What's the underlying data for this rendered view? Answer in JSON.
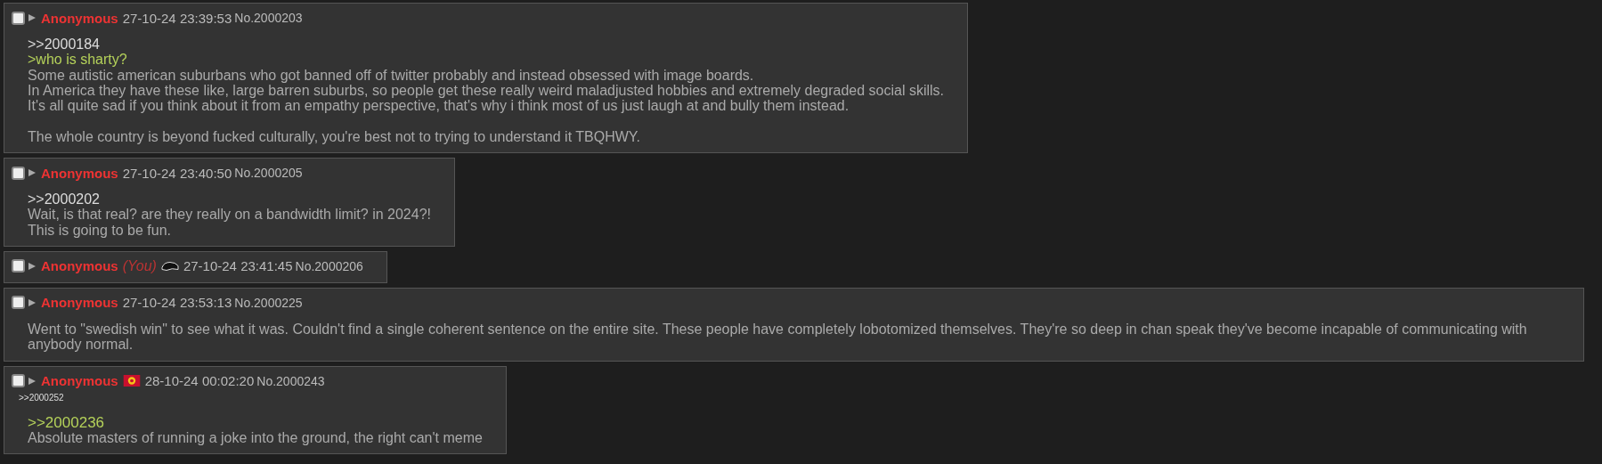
{
  "posts": [
    {
      "checked": false,
      "name": "Anonymous",
      "date": "27-10-24 23:39:53",
      "number": "No.2000203",
      "body": [
        {
          "kind": "quotelink",
          "text": ">>2000184"
        },
        {
          "kind": "greentext",
          "text": ">who is sharty?"
        },
        {
          "kind": "text",
          "text": "Some autistic american suburbans who got banned off of twitter probably and instead obsessed with image boards."
        },
        {
          "kind": "text",
          "text": "In America they have these like, large barren suburbs, so people get these really weird maladjusted hobbies and extremely degraded social skills."
        },
        {
          "kind": "text",
          "text": "It's all quite sad if you think about it from an empathy perspective, that's why i think most of us just laugh at and bully them instead."
        },
        {
          "kind": "gap"
        },
        {
          "kind": "text",
          "text": "The whole country is beyond fucked culturally, you're best not to trying to understand it TBQHWY."
        }
      ]
    },
    {
      "checked": false,
      "name": "Anonymous",
      "date": "27-10-24 23:40:50",
      "number": "No.2000205",
      "body": [
        {
          "kind": "quotelink",
          "text": ">>2000202"
        },
        {
          "kind": "text",
          "text": "Wait, is that real? are they really on a bandwidth limit? in 2024?!"
        },
        {
          "kind": "text",
          "text": "This is going to be fun."
        }
      ]
    },
    {
      "checked": false,
      "name": "Anonymous",
      "you": "(You)",
      "flag": {
        "kind": "cap"
      },
      "date": "27-10-24 23:41:45",
      "number": "No.2000206"
    },
    {
      "checked": false,
      "name": "Anonymous",
      "date": "27-10-24 23:53:13",
      "number": "No.2000225",
      "body": [
        {
          "kind": "text",
          "text": "Went to \"swedish win\" to see what it was. Couldn't find a single coherent sentence on the entire site. These people have completely lobotomized themselves. They're so deep in chan speak they've become incapable of communicating with anybody normal."
        }
      ]
    },
    {
      "checked": false,
      "name": "Anonymous",
      "flag": {
        "kind": "sun"
      },
      "date": "28-10-24 00:02:20",
      "number": "No.2000243",
      "backlinks": [
        ">>2000252"
      ],
      "body": [
        {
          "kind": "greenlink",
          "text": ">>2000236"
        },
        {
          "kind": "text",
          "text": "Absolute masters of running a joke into the ground, the right can't meme"
        }
      ]
    }
  ]
}
